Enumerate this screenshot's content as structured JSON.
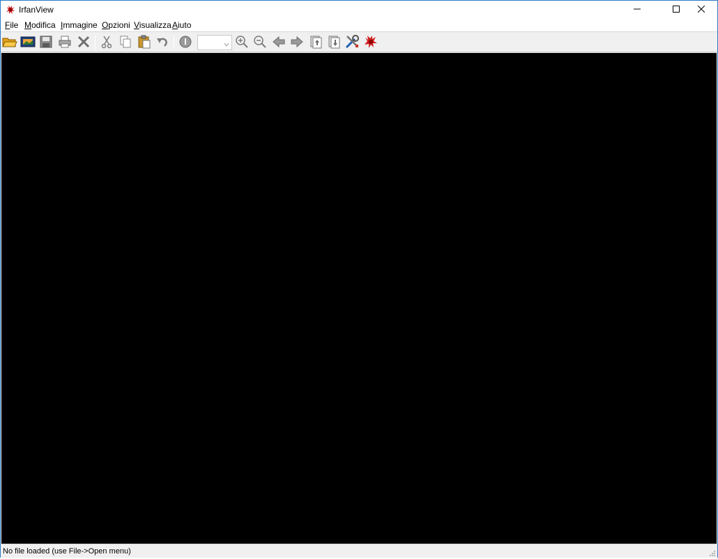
{
  "window": {
    "title": "IrfanView",
    "icon": "irfanview-red-cat-icon"
  },
  "titlebar_buttons": {
    "minimize": "minimize-icon",
    "maximize": "maximize-icon",
    "close": "close-icon"
  },
  "menu": {
    "items": [
      "File",
      "Modifica",
      "Immagine",
      "Opzioni",
      "Visualizza",
      "Aiuto"
    ]
  },
  "toolbar": {
    "buttons": [
      "open-folder-icon",
      "slideshow-icon",
      "save-icon",
      "print-icon",
      "delete-icon",
      "cut-icon",
      "copy-icon",
      "paste-icon",
      "undo-icon",
      "info-icon",
      "zoom-in-icon",
      "zoom-out-icon",
      "previous-icon",
      "next-icon",
      "first-page-icon",
      "last-page-icon",
      "settings-icon",
      "irfanview-icon"
    ],
    "zoom_value": ""
  },
  "viewer": {
    "background": "#000000"
  },
  "status": {
    "text": "No file loaded (use File->Open menu)"
  },
  "colors": {
    "border": "#2b79c8",
    "toolbar_bg": "#f0f0f0",
    "viewer_bg": "#000000"
  }
}
